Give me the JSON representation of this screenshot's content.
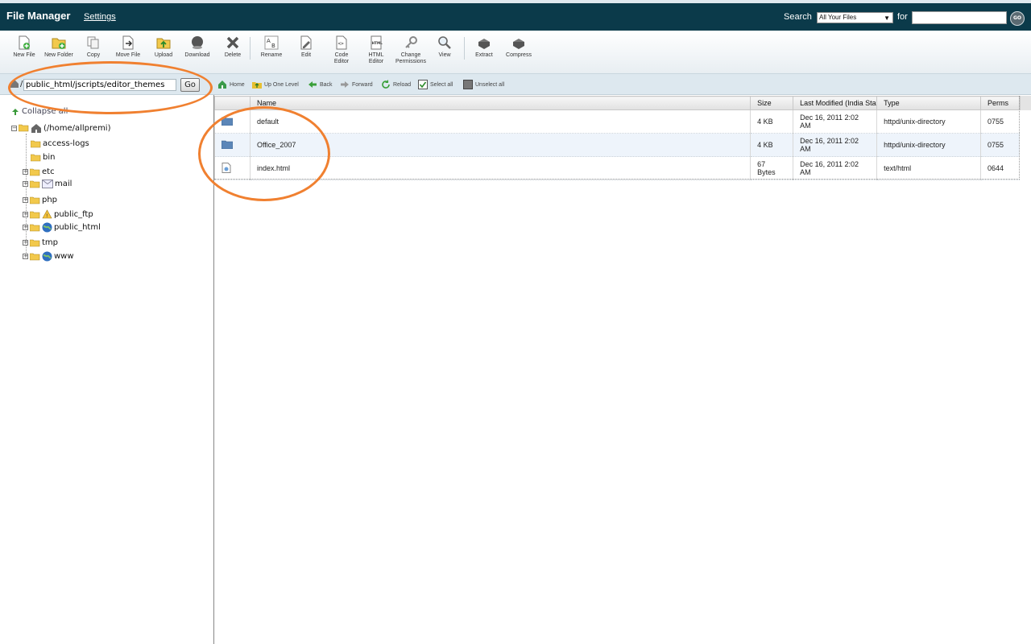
{
  "header": {
    "title": "File Manager",
    "settings_label": "Settings",
    "search_label": "Search",
    "search_scope": "All Your Files",
    "for_label": "for",
    "search_value": "",
    "go_label": "GO"
  },
  "toolbar": {
    "items": [
      {
        "label": "New File",
        "icon": "new-file-icon"
      },
      {
        "label": "New Folder",
        "icon": "new-folder-icon"
      },
      {
        "label": "Copy",
        "icon": "copy-icon"
      },
      {
        "label": "Move File",
        "icon": "move-file-icon"
      },
      {
        "label": "Upload",
        "icon": "upload-icon"
      },
      {
        "label": "Download",
        "icon": "download-icon"
      },
      {
        "label": "Delete",
        "icon": "delete-icon"
      },
      {
        "label": "Rename",
        "icon": "rename-icon"
      },
      {
        "label": "Edit",
        "icon": "edit-icon"
      },
      {
        "label": "Code Editor",
        "icon": "code-editor-icon"
      },
      {
        "label": "HTML Editor",
        "icon": "html-editor-icon"
      },
      {
        "label": "Change Permissions",
        "icon": "change-permissions-icon"
      },
      {
        "label": "View",
        "icon": "view-icon"
      },
      {
        "label": "Extract",
        "icon": "extract-icon"
      },
      {
        "label": "Compress",
        "icon": "compress-icon"
      }
    ]
  },
  "pathbar": {
    "slash": "/",
    "path_value": "public_html/jscripts/editor_themes",
    "go_label": "Go",
    "nav": {
      "home": "Home",
      "up": "Up One Level",
      "back": "Back",
      "forward": "Forward",
      "reload": "Reload",
      "select_all": "Select all",
      "unselect_all": "Unselect all"
    }
  },
  "tree": {
    "collapse_all": "Collapse all",
    "root": "(/home/allpremi)",
    "items": [
      {
        "label": "access-logs"
      },
      {
        "label": "bin"
      },
      {
        "label": "etc"
      },
      {
        "label": "mail"
      },
      {
        "label": "php"
      },
      {
        "label": "public_ftp"
      },
      {
        "label": "public_html"
      },
      {
        "label": "tmp"
      },
      {
        "label": "www"
      }
    ]
  },
  "table": {
    "columns": {
      "name": "Name",
      "size": "Size",
      "modified": "Last Modified (India Sta",
      "type": "Type",
      "perms": "Perms"
    },
    "rows": [
      {
        "name": "default",
        "size": "4 KB",
        "modified_line1": "Dec 16, 2011 2:02",
        "modified_line2": "AM",
        "type": "httpd/unix-directory",
        "perms": "0755",
        "icon": "folder-icon"
      },
      {
        "name": "Office_2007",
        "size": "4 KB",
        "modified_line1": "Dec 16, 2011 2:02",
        "modified_line2": "AM",
        "type": "httpd/unix-directory",
        "perms": "0755",
        "icon": "folder-icon"
      },
      {
        "name": "index.html",
        "size_line1": "67",
        "size_line2": "Bytes",
        "modified_line1": "Dec 16, 2011 2:02",
        "modified_line2": "AM",
        "type": "text/html",
        "perms": "0644",
        "icon": "file-icon"
      }
    ]
  },
  "colors": {
    "header_bg": "#0b3a4a",
    "annotation": "#f08030",
    "row_alt": "#eef4fb"
  }
}
